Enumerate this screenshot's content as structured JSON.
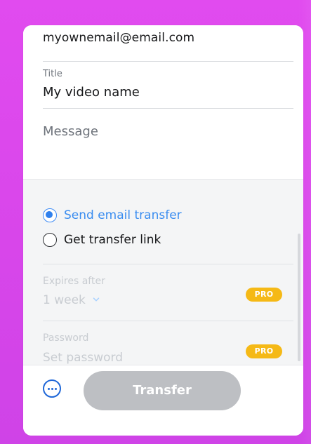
{
  "form": {
    "email_value": "myownemail@email.com",
    "title_label": "Title",
    "title_value": "My video name",
    "message_placeholder": "Message"
  },
  "options": {
    "send_email_transfer_label": "Send email transfer",
    "get_transfer_link_label": "Get transfer link",
    "selected_mode": "Send email transfer",
    "expires_after_label": "Expires after",
    "expires_after_value": "1 week",
    "password_label": "Password",
    "password_placeholder": "Set password",
    "pro_badge_label": "PRO"
  },
  "footer": {
    "transfer_button_label": "Transfer"
  },
  "icons": {
    "more_options": "more-options-icon",
    "expires_dropdown": "chevron-down-icon"
  },
  "colors": {
    "accent_blue": "#2f80ed",
    "pro_badge_yellow": "#f5b916",
    "disabled_button": "#bdbfc3",
    "background_magenta": "#d846ea"
  }
}
